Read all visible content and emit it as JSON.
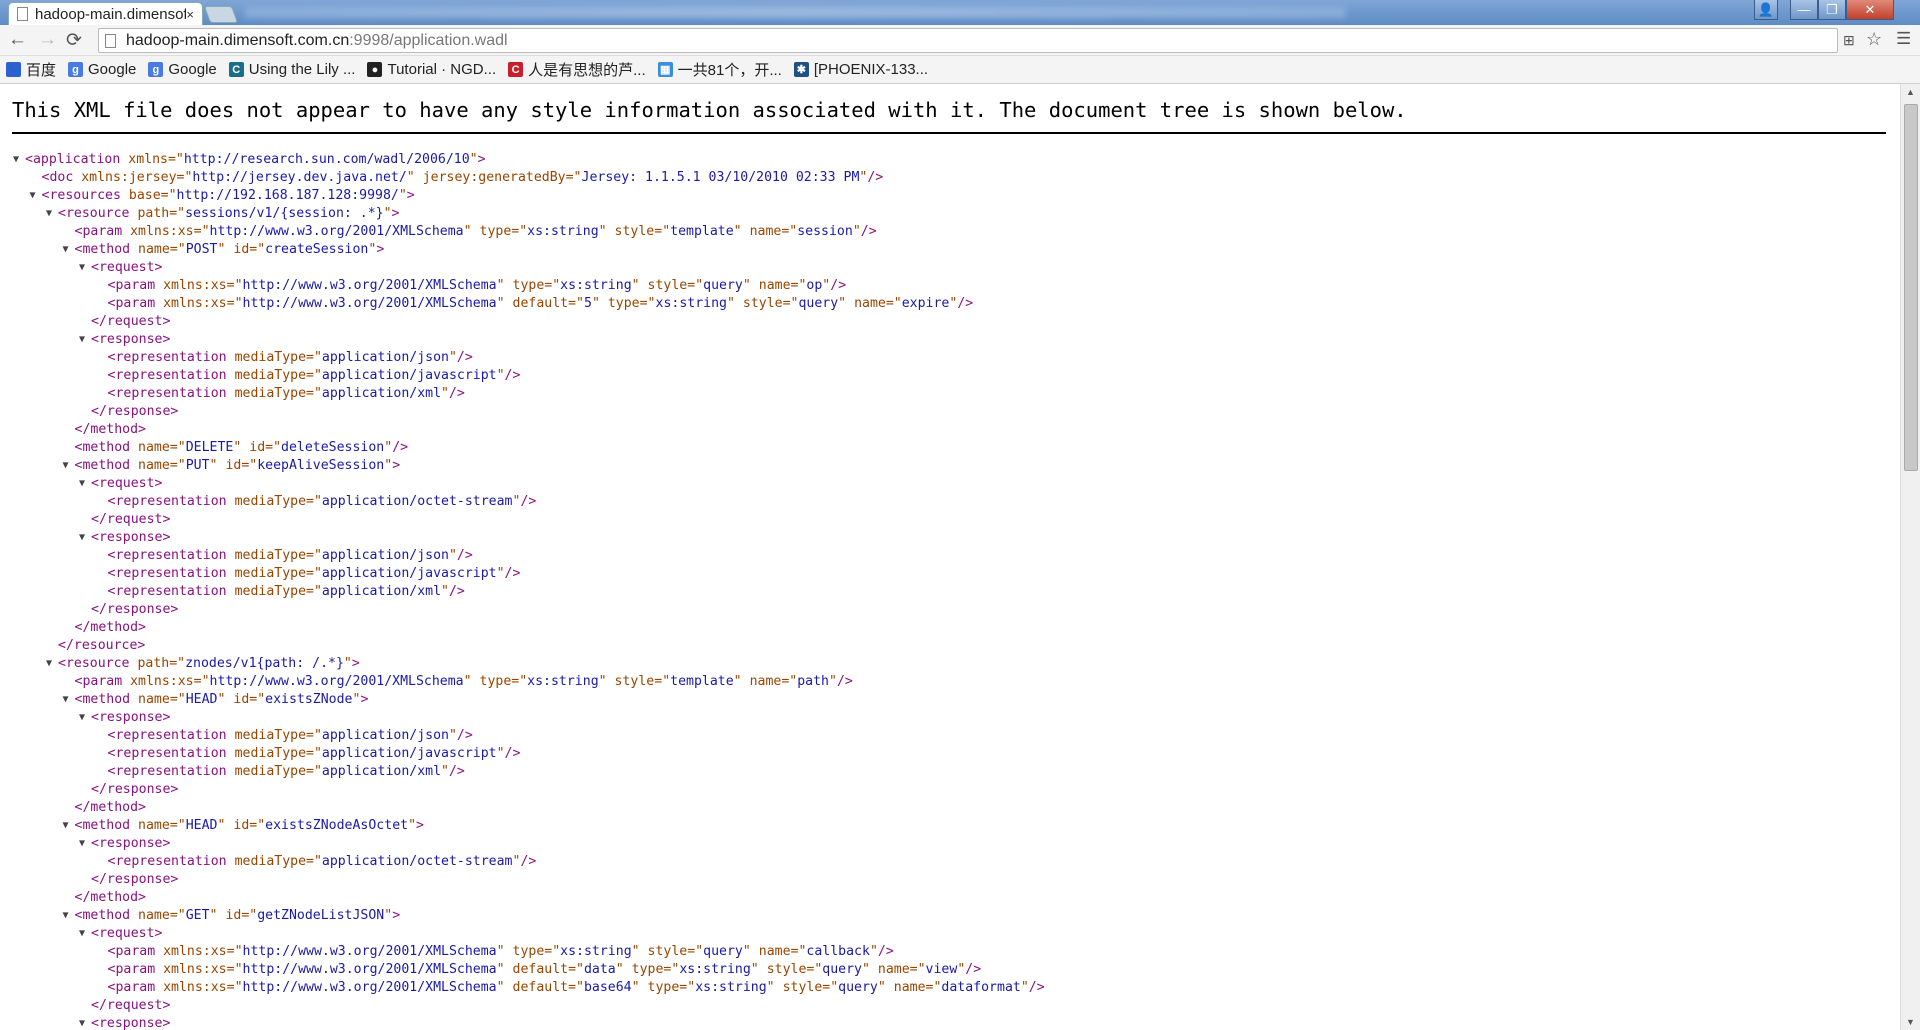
{
  "browser": {
    "tab_title": "hadoop-main.dimensoft.com.cn/application.wadl",
    "tab_close": "×",
    "url_host": "hadoop-main.dimensoft.com.cn",
    "url_path": ":9998/application.wadl",
    "window_controls": {
      "minimize": "—",
      "maximize": "❐",
      "close": "✕",
      "user": "👤"
    },
    "nav": {
      "back": "←",
      "forward": "→",
      "reload": "⟳"
    },
    "bookmarks": [
      {
        "label": "百度",
        "icon": "baidu-icon",
        "color": "#2f5fd0",
        "glyph": "🐾"
      },
      {
        "label": "Google",
        "icon": "google-icon",
        "color": "#4a7be0",
        "glyph": "g"
      },
      {
        "label": "Google",
        "icon": "google-icon",
        "color": "#4a7be0",
        "glyph": "g"
      },
      {
        "label": "Using the Lily ...",
        "icon": "c-icon",
        "color": "#1b6e8a",
        "glyph": "C"
      },
      {
        "label": "Tutorial · NGD...",
        "icon": "github-icon",
        "color": "#222",
        "glyph": "●"
      },
      {
        "label": "人是有思想的芦...",
        "icon": "csdn-icon",
        "color": "#c8202a",
        "glyph": "C"
      },
      {
        "label": "一共81个，开...",
        "icon": "grid-icon",
        "color": "#3a8ee0",
        "glyph": "▦"
      },
      {
        "label": "[PHOENIX-133...",
        "icon": "jira-icon",
        "color": "#205081",
        "glyph": "✱"
      }
    ]
  },
  "message": "This XML file does not appear to have any style information associated with it. The document tree is shown below.",
  "tree": [
    {
      "d": 0,
      "t": 1,
      "tag": "application",
      "attrs": [
        [
          "xmlns",
          "http://research.sun.com/wadl/2006/10"
        ]
      ]
    },
    {
      "d": 1,
      "t": 0,
      "tag": "doc",
      "self": 1,
      "attrs": [
        [
          "xmlns:jersey",
          "http://jersey.dev.java.net/"
        ],
        [
          "jersey:generatedBy",
          "Jersey: 1.1.5.1 03/10/2010 02:33 PM"
        ]
      ]
    },
    {
      "d": 1,
      "t": 1,
      "tag": "resources",
      "attrs": [
        [
          "base",
          "http://192.168.187.128:9998/"
        ]
      ]
    },
    {
      "d": 2,
      "t": 1,
      "tag": "resource",
      "attrs": [
        [
          "path",
          "sessions/v1/{session: .*}"
        ]
      ]
    },
    {
      "d": 3,
      "t": 0,
      "tag": "param",
      "self": 1,
      "attrs": [
        [
          "xmlns:xs",
          "http://www.w3.org/2001/XMLSchema"
        ],
        [
          "type",
          "xs:string"
        ],
        [
          "style",
          "template"
        ],
        [
          "name",
          "session"
        ]
      ]
    },
    {
      "d": 3,
      "t": 1,
      "tag": "method",
      "attrs": [
        [
          "name",
          "POST"
        ],
        [
          "id",
          "createSession"
        ]
      ]
    },
    {
      "d": 4,
      "t": 1,
      "tag": "request",
      "attrs": []
    },
    {
      "d": 5,
      "t": 0,
      "tag": "param",
      "self": 1,
      "attrs": [
        [
          "xmlns:xs",
          "http://www.w3.org/2001/XMLSchema"
        ],
        [
          "type",
          "xs:string"
        ],
        [
          "style",
          "query"
        ],
        [
          "name",
          "op"
        ]
      ]
    },
    {
      "d": 5,
      "t": 0,
      "tag": "param",
      "self": 1,
      "attrs": [
        [
          "xmlns:xs",
          "http://www.w3.org/2001/XMLSchema"
        ],
        [
          "default",
          "5"
        ],
        [
          "type",
          "xs:string"
        ],
        [
          "style",
          "query"
        ],
        [
          "name",
          "expire"
        ]
      ]
    },
    {
      "d": 4,
      "t": 0,
      "tag": "request",
      "close": 1
    },
    {
      "d": 4,
      "t": 1,
      "tag": "response",
      "attrs": []
    },
    {
      "d": 5,
      "t": 0,
      "tag": "representation",
      "self": 1,
      "attrs": [
        [
          "mediaType",
          "application/json"
        ]
      ]
    },
    {
      "d": 5,
      "t": 0,
      "tag": "representation",
      "self": 1,
      "attrs": [
        [
          "mediaType",
          "application/javascript"
        ]
      ]
    },
    {
      "d": 5,
      "t": 0,
      "tag": "representation",
      "self": 1,
      "attrs": [
        [
          "mediaType",
          "application/xml"
        ]
      ]
    },
    {
      "d": 4,
      "t": 0,
      "tag": "response",
      "close": 1
    },
    {
      "d": 3,
      "t": 0,
      "tag": "method",
      "close": 1
    },
    {
      "d": 3,
      "t": 0,
      "tag": "method",
      "self": 1,
      "attrs": [
        [
          "name",
          "DELETE"
        ],
        [
          "id",
          "deleteSession"
        ]
      ]
    },
    {
      "d": 3,
      "t": 1,
      "tag": "method",
      "attrs": [
        [
          "name",
          "PUT"
        ],
        [
          "id",
          "keepAliveSession"
        ]
      ]
    },
    {
      "d": 4,
      "t": 1,
      "tag": "request",
      "attrs": []
    },
    {
      "d": 5,
      "t": 0,
      "tag": "representation",
      "self": 1,
      "attrs": [
        [
          "mediaType",
          "application/octet-stream"
        ]
      ]
    },
    {
      "d": 4,
      "t": 0,
      "tag": "request",
      "close": 1
    },
    {
      "d": 4,
      "t": 1,
      "tag": "response",
      "attrs": []
    },
    {
      "d": 5,
      "t": 0,
      "tag": "representation",
      "self": 1,
      "attrs": [
        [
          "mediaType",
          "application/json"
        ]
      ]
    },
    {
      "d": 5,
      "t": 0,
      "tag": "representation",
      "self": 1,
      "attrs": [
        [
          "mediaType",
          "application/javascript"
        ]
      ]
    },
    {
      "d": 5,
      "t": 0,
      "tag": "representation",
      "self": 1,
      "attrs": [
        [
          "mediaType",
          "application/xml"
        ]
      ]
    },
    {
      "d": 4,
      "t": 0,
      "tag": "response",
      "close": 1
    },
    {
      "d": 3,
      "t": 0,
      "tag": "method",
      "close": 1
    },
    {
      "d": 2,
      "t": 0,
      "tag": "resource",
      "close": 1
    },
    {
      "d": 2,
      "t": 1,
      "tag": "resource",
      "attrs": [
        [
          "path",
          "znodes/v1{path: /.*}"
        ]
      ]
    },
    {
      "d": 3,
      "t": 0,
      "tag": "param",
      "self": 1,
      "attrs": [
        [
          "xmlns:xs",
          "http://www.w3.org/2001/XMLSchema"
        ],
        [
          "type",
          "xs:string"
        ],
        [
          "style",
          "template"
        ],
        [
          "name",
          "path"
        ]
      ]
    },
    {
      "d": 3,
      "t": 1,
      "tag": "method",
      "attrs": [
        [
          "name",
          "HEAD"
        ],
        [
          "id",
          "existsZNode"
        ]
      ]
    },
    {
      "d": 4,
      "t": 1,
      "tag": "response",
      "attrs": []
    },
    {
      "d": 5,
      "t": 0,
      "tag": "representation",
      "self": 1,
      "attrs": [
        [
          "mediaType",
          "application/json"
        ]
      ]
    },
    {
      "d": 5,
      "t": 0,
      "tag": "representation",
      "self": 1,
      "attrs": [
        [
          "mediaType",
          "application/javascript"
        ]
      ]
    },
    {
      "d": 5,
      "t": 0,
      "tag": "representation",
      "self": 1,
      "attrs": [
        [
          "mediaType",
          "application/xml"
        ]
      ]
    },
    {
      "d": 4,
      "t": 0,
      "tag": "response",
      "close": 1
    },
    {
      "d": 3,
      "t": 0,
      "tag": "method",
      "close": 1
    },
    {
      "d": 3,
      "t": 1,
      "tag": "method",
      "attrs": [
        [
          "name",
          "HEAD"
        ],
        [
          "id",
          "existsZNodeAsOctet"
        ]
      ]
    },
    {
      "d": 4,
      "t": 1,
      "tag": "response",
      "attrs": []
    },
    {
      "d": 5,
      "t": 0,
      "tag": "representation",
      "self": 1,
      "attrs": [
        [
          "mediaType",
          "application/octet-stream"
        ]
      ]
    },
    {
      "d": 4,
      "t": 0,
      "tag": "response",
      "close": 1
    },
    {
      "d": 3,
      "t": 0,
      "tag": "method",
      "close": 1
    },
    {
      "d": 3,
      "t": 1,
      "tag": "method",
      "attrs": [
        [
          "name",
          "GET"
        ],
        [
          "id",
          "getZNodeListJSON"
        ]
      ]
    },
    {
      "d": 4,
      "t": 1,
      "tag": "request",
      "attrs": []
    },
    {
      "d": 5,
      "t": 0,
      "tag": "param",
      "self": 1,
      "attrs": [
        [
          "xmlns:xs",
          "http://www.w3.org/2001/XMLSchema"
        ],
        [
          "type",
          "xs:string"
        ],
        [
          "style",
          "query"
        ],
        [
          "name",
          "callback"
        ]
      ]
    },
    {
      "d": 5,
      "t": 0,
      "tag": "param",
      "self": 1,
      "attrs": [
        [
          "xmlns:xs",
          "http://www.w3.org/2001/XMLSchema"
        ],
        [
          "default",
          "data"
        ],
        [
          "type",
          "xs:string"
        ],
        [
          "style",
          "query"
        ],
        [
          "name",
          "view"
        ]
      ]
    },
    {
      "d": 5,
      "t": 0,
      "tag": "param",
      "self": 1,
      "attrs": [
        [
          "xmlns:xs",
          "http://www.w3.org/2001/XMLSchema"
        ],
        [
          "default",
          "base64"
        ],
        [
          "type",
          "xs:string"
        ],
        [
          "style",
          "query"
        ],
        [
          "name",
          "dataformat"
        ]
      ]
    },
    {
      "d": 4,
      "t": 0,
      "tag": "request",
      "close": 1
    },
    {
      "d": 4,
      "t": 1,
      "tag": "response",
      "attrs": []
    }
  ],
  "colors": {
    "tag": "#881280",
    "attr_name": "#994500",
    "attr_value": "#1a1aa6"
  }
}
